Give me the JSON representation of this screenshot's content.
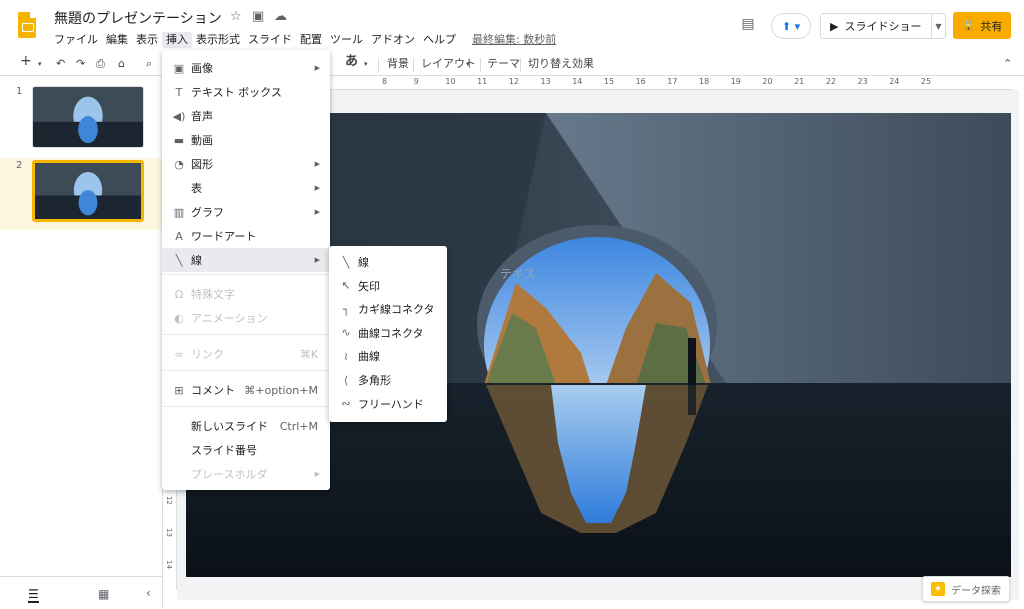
{
  "app": {
    "title": "無題のプレゼンテーション",
    "menu": [
      "ファイル",
      "編集",
      "表示",
      "挿入",
      "表示形式",
      "スライド",
      "配置",
      "ツール",
      "アドオン",
      "ヘルプ"
    ],
    "last_edit": "最終編集: 数秒前",
    "slideshow_label": "スライドショー",
    "share_label": "共有"
  },
  "toolbar": {
    "font_glyph": "あ",
    "background_label": "背景",
    "layout_label": "レイアウト",
    "theme_label": "テーマ",
    "transition_label": "切り替え効果"
  },
  "ruler": {
    "top_ticks": [
      "8",
      "9",
      "10",
      "11",
      "12",
      "13",
      "14",
      "15",
      "16",
      "17",
      "18",
      "19",
      "20",
      "21",
      "22",
      "23",
      "24",
      "25"
    ],
    "left_ticks": [
      "12",
      "13",
      "14"
    ]
  },
  "filmstrip": {
    "slides": [
      {
        "num": "1"
      },
      {
        "num": "2"
      }
    ]
  },
  "slide": {
    "text": "テキス"
  },
  "insert_menu": {
    "items": [
      {
        "label": "画像",
        "icon": "image-icon",
        "arrow": true
      },
      {
        "label": "テキスト ボックス",
        "icon": "textbox-icon"
      },
      {
        "label": "音声",
        "icon": "audio-icon"
      },
      {
        "label": "動画",
        "icon": "video-icon"
      },
      {
        "label": "図形",
        "icon": "shape-icon",
        "arrow": true
      },
      {
        "label": "表",
        "arrow": true
      },
      {
        "label": "グラフ",
        "icon": "chart-icon",
        "arrow": true
      },
      {
        "label": "ワードアート",
        "icon": "wordart-icon"
      },
      {
        "label": "線",
        "icon": "line-icon",
        "arrow": true
      },
      {
        "label": "特殊文字",
        "icon": "omega-icon",
        "disabled": true
      },
      {
        "label": "アニメーション",
        "icon": "animation-icon",
        "disabled": true
      },
      {
        "label": "リンク",
        "icon": "link-icon",
        "shortcut": "⌘K",
        "disabled": true
      },
      {
        "label": "コメント",
        "icon": "comment-icon",
        "shortcut": "⌘+option+M"
      },
      {
        "label": "新しいスライド",
        "shortcut": "Ctrl+M"
      },
      {
        "label": "スライド番号"
      },
      {
        "label": "プレースホルダ",
        "arrow": true,
        "disabled": true
      }
    ]
  },
  "line_submenu": {
    "items": [
      {
        "label": "線",
        "icon": "line-icon"
      },
      {
        "label": "矢印",
        "icon": "arrow-icon"
      },
      {
        "label": "カギ線コネクタ",
        "icon": "elbow-connector-icon"
      },
      {
        "label": "曲線コネクタ",
        "icon": "curved-connector-icon"
      },
      {
        "label": "曲線",
        "icon": "curve-icon"
      },
      {
        "label": "多角形",
        "icon": "polyline-icon"
      },
      {
        "label": "フリーハンド",
        "icon": "scribble-icon"
      }
    ]
  },
  "explore": {
    "label": "データ探索"
  },
  "colors": {
    "brand": "#f4b400",
    "share": "#f9ab00",
    "accent_blue": "#1a73e8"
  }
}
